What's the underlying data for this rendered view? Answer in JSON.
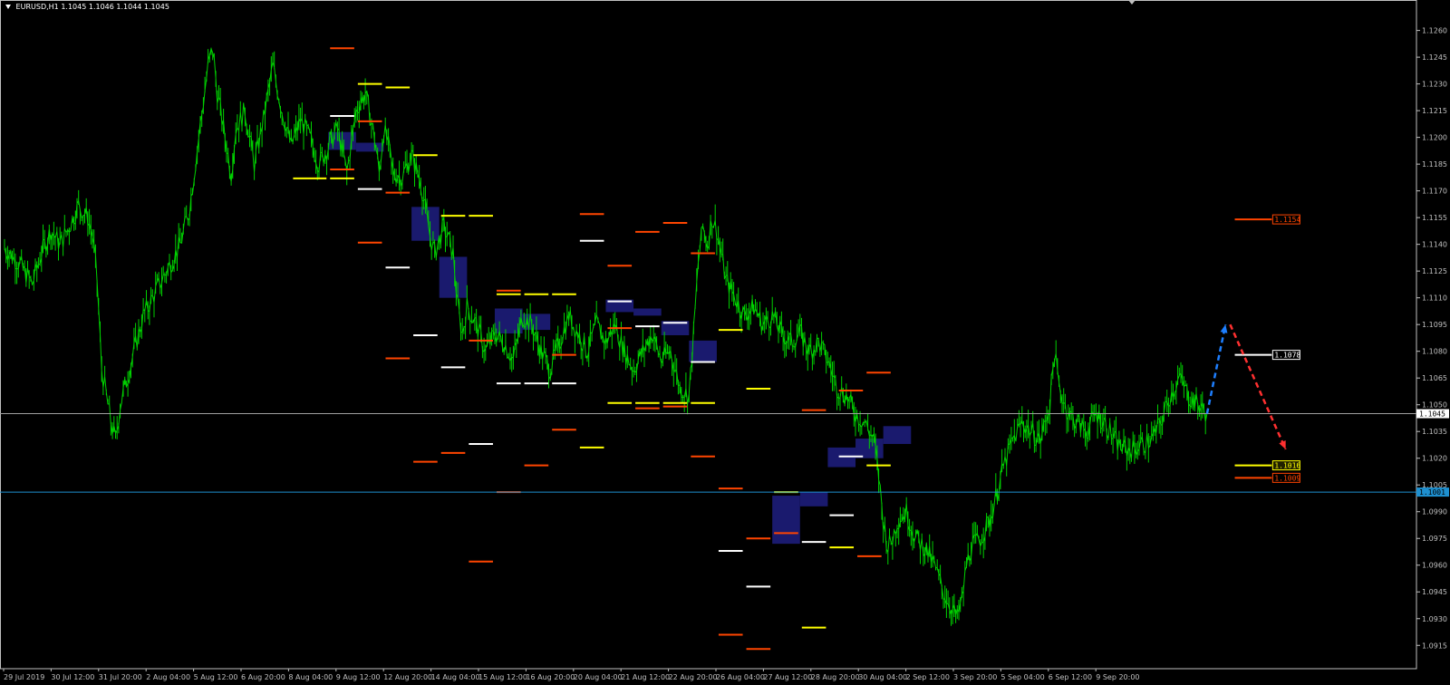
{
  "header": {
    "symbol": "EURUSD,H1",
    "ohlc": "1.1045 1.1046 1.1044 1.1045"
  },
  "colors": {
    "background": "#000000",
    "candles": "#00d000",
    "axis": "#c0c0c0",
    "bid_line": "#a0a0a0",
    "level_line": "#1e90d0",
    "zone": "#1a1a6e",
    "orange_level": "#ff4500",
    "yellow_level": "#ffff00",
    "white_level": "#ffffff",
    "arrow_up": "#1e7fff",
    "arrow_down": "#ff3030"
  },
  "chart_data": {
    "type": "line",
    "title": "EURUSD,H1",
    "price_range": [
      1.0907,
      1.1272
    ],
    "y_ticks": [
      "1.1260",
      "1.1245",
      "1.1230",
      "1.1215",
      "1.1200",
      "1.1185",
      "1.1170",
      "1.1155",
      "1.1140",
      "1.1125",
      "1.1110",
      "1.1095",
      "1.1080",
      "1.1065",
      "1.1050",
      "1.1035",
      "1.1020",
      "1.1005",
      "1.0990",
      "1.0975",
      "1.0960",
      "1.0945",
      "1.0930",
      "1.0915"
    ],
    "x_ticks": [
      "29 Jul 2019",
      "30 Jul 12:00",
      "31 Jul 20:00",
      "2 Aug 04:00",
      "5 Aug 12:00",
      "6 Aug 20:00",
      "8 Aug 04:00",
      "9 Aug 12:00",
      "12 Aug 20:00",
      "14 Aug 04:00",
      "15 Aug 12:00",
      "16 Aug 20:00",
      "20 Aug 04:00",
      "21 Aug 12:00",
      "22 Aug 20:00",
      "26 Aug 04:00",
      "27 Aug 12:00",
      "28 Aug 20:00",
      "30 Aug 04:00",
      "2 Sep 12:00",
      "3 Sep 20:00",
      "5 Sep 04:00",
      "6 Sep 12:00",
      "9 Sep 20:00"
    ],
    "price_path": [
      [
        0,
        1.1138
      ],
      [
        3,
        1.113
      ],
      [
        6,
        1.1118
      ],
      [
        8,
        1.1135
      ],
      [
        10,
        1.1148
      ],
      [
        12,
        1.114
      ],
      [
        14,
        1.115
      ],
      [
        16,
        1.1162
      ],
      [
        18,
        1.1155
      ],
      [
        19,
        1.1145
      ],
      [
        20,
        1.112
      ],
      [
        21,
        1.107
      ],
      [
        22,
        1.1055
      ],
      [
        23,
        1.104
      ],
      [
        24,
        1.103
      ],
      [
        25,
        1.105
      ],
      [
        26,
        1.106
      ],
      [
        28,
        1.108
      ],
      [
        30,
        1.11
      ],
      [
        32,
        1.111
      ],
      [
        34,
        1.112
      ],
      [
        36,
        1.113
      ],
      [
        38,
        1.114
      ],
      [
        40,
        1.116
      ],
      [
        41,
        1.118
      ],
      [
        42,
        1.12
      ],
      [
        43,
        1.122
      ],
      [
        44,
        1.124
      ],
      [
        45,
        1.125
      ],
      [
        46,
        1.1225
      ],
      [
        47,
        1.121
      ],
      [
        48,
        1.1195
      ],
      [
        49,
        1.118
      ],
      [
        50,
        1.1205
      ],
      [
        52,
        1.1215
      ],
      [
        54,
        1.1185
      ],
      [
        56,
        1.121
      ],
      [
        58,
        1.124
      ],
      [
        60,
        1.1215
      ],
      [
        62,
        1.1195
      ],
      [
        64,
        1.121
      ],
      [
        66,
        1.12
      ],
      [
        68,
        1.1185
      ],
      [
        70,
        1.1195
      ],
      [
        72,
        1.1205
      ],
      [
        74,
        1.118
      ],
      [
        76,
        1.1215
      ],
      [
        78,
        1.1225
      ],
      [
        80,
        1.12
      ],
      [
        81,
        1.118
      ],
      [
        82,
        1.1205
      ],
      [
        83,
        1.1195
      ],
      [
        84,
        1.118
      ],
      [
        86,
        1.1178
      ],
      [
        88,
        1.119
      ],
      [
        90,
        1.1175
      ],
      [
        92,
        1.1145
      ],
      [
        93,
        1.1135
      ],
      [
        95,
        1.115
      ],
      [
        97,
        1.1135
      ],
      [
        98,
        1.1105
      ],
      [
        99,
        1.109
      ],
      [
        100,
        1.1105
      ],
      [
        102,
        1.1095
      ],
      [
        104,
        1.108
      ],
      [
        106,
        1.109
      ],
      [
        108,
        1.1085
      ],
      [
        110,
        1.1075
      ],
      [
        112,
        1.11
      ],
      [
        114,
        1.1095
      ],
      [
        116,
        1.108
      ],
      [
        118,
        1.107
      ],
      [
        120,
        1.1085
      ],
      [
        122,
        1.11
      ],
      [
        124,
        1.109
      ],
      [
        126,
        1.108
      ],
      [
        128,
        1.1095
      ],
      [
        130,
        1.1085
      ],
      [
        132,
        1.1095
      ],
      [
        134,
        1.108
      ],
      [
        136,
        1.107
      ],
      [
        138,
        1.108
      ],
      [
        140,
        1.109
      ],
      [
        142,
        1.1075
      ],
      [
        144,
        1.108
      ],
      [
        146,
        1.106
      ],
      [
        148,
        1.1055
      ],
      [
        149,
        1.109
      ],
      [
        150,
        1.113
      ],
      [
        151,
        1.115
      ],
      [
        152,
        1.114
      ],
      [
        153,
        1.1155
      ],
      [
        154,
        1.1148
      ],
      [
        156,
        1.112
      ],
      [
        158,
        1.111
      ],
      [
        160,
        1.11
      ],
      [
        162,
        1.1105
      ],
      [
        164,
        1.1095
      ],
      [
        166,
        1.11
      ],
      [
        168,
        1.109
      ],
      [
        170,
        1.1085
      ],
      [
        172,
        1.109
      ],
      [
        174,
        1.108
      ],
      [
        176,
        1.1085
      ],
      [
        178,
        1.1075
      ],
      [
        180,
        1.106
      ],
      [
        182,
        1.1055
      ],
      [
        184,
        1.1045
      ],
      [
        186,
        1.104
      ],
      [
        188,
        1.103
      ],
      [
        189,
        1.101
      ],
      [
        190,
        1.0985
      ],
      [
        191,
        1.097
      ],
      [
        192,
        1.0975
      ],
      [
        193,
        1.0985
      ],
      [
        195,
        1.099
      ],
      [
        197,
        1.0975
      ],
      [
        199,
        1.097
      ],
      [
        201,
        1.096
      ],
      [
        203,
        1.0945
      ],
      [
        205,
        1.0935
      ],
      [
        206,
        1.093
      ],
      [
        207,
        1.094
      ],
      [
        208,
        1.096
      ],
      [
        209,
        1.097
      ],
      [
        211,
        1.0975
      ],
      [
        213,
        1.0985
      ],
      [
        214,
        1.0995
      ],
      [
        215,
        1.1005
      ],
      [
        216,
        1.1015
      ],
      [
        218,
        1.103
      ],
      [
        220,
        1.104
      ],
      [
        222,
        1.1035
      ],
      [
        224,
        1.103
      ],
      [
        226,
        1.105
      ],
      [
        227,
        1.108
      ],
      [
        228,
        1.106
      ],
      [
        230,
        1.1045
      ],
      [
        232,
        1.104
      ],
      [
        234,
        1.1035
      ],
      [
        236,
        1.1045
      ],
      [
        238,
        1.104
      ],
      [
        240,
        1.103
      ],
      [
        242,
        1.1025
      ],
      [
        244,
        1.1025
      ],
      [
        246,
        1.1028
      ],
      [
        248,
        1.103
      ],
      [
        250,
        1.104
      ],
      [
        252,
        1.1055
      ],
      [
        254,
        1.1065
      ],
      [
        256,
        1.1055
      ],
      [
        258,
        1.105
      ],
      [
        260,
        1.1045
      ]
    ],
    "price_path_x_range": [
      0,
      260
    ],
    "horizontal_lines": [
      {
        "price": 1.1045,
        "label": "1.1045",
        "role": "bid"
      },
      {
        "price": 1.1001,
        "label": "1.1001",
        "role": "level"
      }
    ],
    "right_labels": [
      {
        "price": 1.1154,
        "label": "1.1154",
        "color": "orange"
      },
      {
        "price": 1.1078,
        "label": "1.1078",
        "color": "white"
      },
      {
        "price": 1.1016,
        "label": "1.1016",
        "color": "yellow"
      },
      {
        "price": 1.1009,
        "label": "1.1009",
        "color": "orange"
      }
    ],
    "level_segments": [
      {
        "t": [
          70,
          76
        ],
        "p": 1.125,
        "c": "orange"
      },
      {
        "t": [
          76,
          82
        ],
        "p": 1.123,
        "c": "yellow"
      },
      {
        "t": [
          82,
          88
        ],
        "p": 1.1228,
        "c": "yellow"
      },
      {
        "t": [
          70,
          76
        ],
        "p": 1.1212,
        "c": "white"
      },
      {
        "t": [
          76,
          82
        ],
        "p": 1.1209,
        "c": "orange"
      },
      {
        "t": [
          88,
          94
        ],
        "p": 1.119,
        "c": "yellow"
      },
      {
        "t": [
          70,
          76
        ],
        "p": 1.1182,
        "c": "orange"
      },
      {
        "t": [
          62,
          70
        ],
        "p": 1.1177,
        "c": "yellow"
      },
      {
        "t": [
          70,
          76
        ],
        "p": 1.1177,
        "c": "yellow"
      },
      {
        "t": [
          76,
          82
        ],
        "p": 1.1171,
        "c": "white"
      },
      {
        "t": [
          82,
          88
        ],
        "p": 1.1169,
        "c": "orange"
      },
      {
        "t": [
          94,
          100
        ],
        "p": 1.1156,
        "c": "yellow"
      },
      {
        "t": [
          100,
          106
        ],
        "p": 1.1156,
        "c": "yellow"
      },
      {
        "t": [
          76,
          82
        ],
        "p": 1.1141,
        "c": "orange"
      },
      {
        "t": [
          82,
          88
        ],
        "p": 1.1127,
        "c": "white"
      },
      {
        "t": [
          106,
          112
        ],
        "p": 1.1114,
        "c": "orange"
      },
      {
        "t": [
          106,
          112
        ],
        "p": 1.1112,
        "c": "yellow"
      },
      {
        "t": [
          112,
          118
        ],
        "p": 1.1112,
        "c": "yellow"
      },
      {
        "t": [
          118,
          124
        ],
        "p": 1.1112,
        "c": "yellow"
      },
      {
        "t": [
          88,
          94
        ],
        "p": 1.1089,
        "c": "white"
      },
      {
        "t": [
          100,
          106
        ],
        "p": 1.1086,
        "c": "orange"
      },
      {
        "t": [
          82,
          88
        ],
        "p": 1.1076,
        "c": "orange"
      },
      {
        "t": [
          94,
          100
        ],
        "p": 1.1071,
        "c": "white"
      },
      {
        "t": [
          106,
          112
        ],
        "p": 1.1062,
        "c": "white"
      },
      {
        "t": [
          112,
          118
        ],
        "p": 1.1062,
        "c": "white"
      },
      {
        "t": [
          118,
          124
        ],
        "p": 1.1062,
        "c": "white"
      },
      {
        "t": [
          118,
          124
        ],
        "p": 1.1078,
        "c": "orange"
      },
      {
        "t": [
          100,
          106
        ],
        "p": 1.1028,
        "c": "white"
      },
      {
        "t": [
          94,
          100
        ],
        "p": 1.1023,
        "c": "orange"
      },
      {
        "t": [
          88,
          94
        ],
        "p": 1.1018,
        "c": "orange"
      },
      {
        "t": [
          112,
          118
        ],
        "p": 1.1016,
        "c": "orange"
      },
      {
        "t": [
          118,
          124
        ],
        "p": 1.1036,
        "c": "orange"
      },
      {
        "t": [
          124,
          130
        ],
        "p": 1.1026,
        "c": "yellow"
      },
      {
        "t": [
          106,
          112
        ],
        "p": 1.1001,
        "c": "orange"
      },
      {
        "t": [
          100,
          106
        ],
        "p": 1.0962,
        "c": "orange"
      },
      {
        "t": [
          124,
          130
        ],
        "p": 1.1157,
        "c": "orange"
      },
      {
        "t": [
          124,
          130
        ],
        "p": 1.1142,
        "c": "white"
      },
      {
        "t": [
          130,
          136
        ],
        "p": 1.1128,
        "c": "orange"
      },
      {
        "t": [
          130,
          136
        ],
        "p": 1.1108,
        "c": "white"
      },
      {
        "t": [
          136,
          142
        ],
        "p": 1.1147,
        "c": "orange"
      },
      {
        "t": [
          142,
          148
        ],
        "p": 1.1152,
        "c": "orange"
      },
      {
        "t": [
          148,
          154
        ],
        "p": 1.1135,
        "c": "orange"
      },
      {
        "t": [
          136,
          142
        ],
        "p": 1.1094,
        "c": "white"
      },
      {
        "t": [
          142,
          148
        ],
        "p": 1.1096,
        "c": "white"
      },
      {
        "t": [
          130,
          136
        ],
        "p": 1.1093,
        "c": "orange"
      },
      {
        "t": [
          154,
          160
        ],
        "p": 1.1092,
        "c": "yellow"
      },
      {
        "t": [
          148,
          154
        ],
        "p": 1.1074,
        "c": "white"
      },
      {
        "t": [
          160,
          166
        ],
        "p": 1.1059,
        "c": "yellow"
      },
      {
        "t": [
          130,
          136
        ],
        "p": 1.1051,
        "c": "yellow"
      },
      {
        "t": [
          136,
          142
        ],
        "p": 1.1051,
        "c": "yellow"
      },
      {
        "t": [
          142,
          148
        ],
        "p": 1.1051,
        "c": "yellow"
      },
      {
        "t": [
          148,
          154
        ],
        "p": 1.1051,
        "c": "yellow"
      },
      {
        "t": [
          136,
          142
        ],
        "p": 1.1048,
        "c": "orange"
      },
      {
        "t": [
          142,
          148
        ],
        "p": 1.1049,
        "c": "orange"
      },
      {
        "t": [
          148,
          154
        ],
        "p": 1.1021,
        "c": "orange"
      },
      {
        "t": [
          154,
          160
        ],
        "p": 1.1003,
        "c": "orange"
      },
      {
        "t": [
          154,
          160
        ],
        "p": 1.0968,
        "c": "white"
      },
      {
        "t": [
          160,
          166
        ],
        "p": 1.0975,
        "c": "orange"
      },
      {
        "t": [
          166,
          172
        ],
        "p": 1.1001,
        "c": "yellow"
      },
      {
        "t": [
          166,
          172
        ],
        "p": 1.0978,
        "c": "orange"
      },
      {
        "t": [
          172,
          178
        ],
        "p": 1.0973,
        "c": "white"
      },
      {
        "t": [
          178,
          184
        ],
        "p": 1.097,
        "c": "yellow"
      },
      {
        "t": [
          184,
          190
        ],
        "p": 1.0965,
        "c": "orange"
      },
      {
        "t": [
          178,
          184
        ],
        "p": 1.0988,
        "c": "white"
      },
      {
        "t": [
          160,
          166
        ],
        "p": 1.0948,
        "c": "white"
      },
      {
        "t": [
          154,
          160
        ],
        "p": 1.0921,
        "c": "orange"
      },
      {
        "t": [
          160,
          166
        ],
        "p": 1.0913,
        "c": "orange"
      },
      {
        "t": [
          172,
          178
        ],
        "p": 1.0925,
        "c": "yellow"
      },
      {
        "t": [
          172,
          178
        ],
        "p": 1.1047,
        "c": "orange"
      },
      {
        "t": [
          180,
          186
        ],
        "p": 1.1058,
        "c": "orange"
      },
      {
        "t": [
          186,
          192
        ],
        "p": 1.1068,
        "c": "orange"
      },
      {
        "t": [
          180,
          186
        ],
        "p": 1.1021,
        "c": "white"
      },
      {
        "t": [
          186,
          192
        ],
        "p": 1.1016,
        "c": "yellow"
      }
    ],
    "zones": [
      {
        "t": [
          70,
          76
        ],
        "p": [
          1.1193,
          1.1203
        ]
      },
      {
        "t": [
          76,
          82
        ],
        "p": [
          1.1192,
          1.1197
        ]
      },
      {
        "t": [
          88,
          94
        ],
        "p": [
          1.1142,
          1.1161
        ]
      },
      {
        "t": [
          94,
          100
        ],
        "p": [
          1.111,
          1.1133
        ]
      },
      {
        "t": [
          106,
          112
        ],
        "p": [
          1.109,
          1.1104
        ]
      },
      {
        "t": [
          112,
          118
        ],
        "p": [
          1.1092,
          1.1101
        ]
      },
      {
        "t": [
          130,
          136
        ],
        "p": [
          1.1102,
          1.1109
        ]
      },
      {
        "t": [
          136,
          142
        ],
        "p": [
          1.11,
          1.1104
        ]
      },
      {
        "t": [
          142,
          148
        ],
        "p": [
          1.1089,
          1.1097
        ]
      },
      {
        "t": [
          148,
          154
        ],
        "p": [
          1.1074,
          1.1086
        ]
      },
      {
        "t": [
          166,
          172
        ],
        "p": [
          1.0972,
          1.0999
        ]
      },
      {
        "t": [
          172,
          178
        ],
        "p": [
          1.0993,
          1.1001
        ]
      },
      {
        "t": [
          178,
          184
        ],
        "p": [
          1.1015,
          1.1026
        ]
      },
      {
        "t": [
          184,
          190
        ],
        "p": [
          1.102,
          1.1031
        ]
      },
      {
        "t": [
          190,
          196
        ],
        "p": [
          1.1028,
          1.1038
        ]
      }
    ],
    "forecast_up": [
      [
        260,
        1.1045
      ],
      [
        264,
        1.1095
      ]
    ],
    "forecast_down": [
      [
        265,
        1.1095
      ],
      [
        277,
        1.1025
      ]
    ]
  }
}
